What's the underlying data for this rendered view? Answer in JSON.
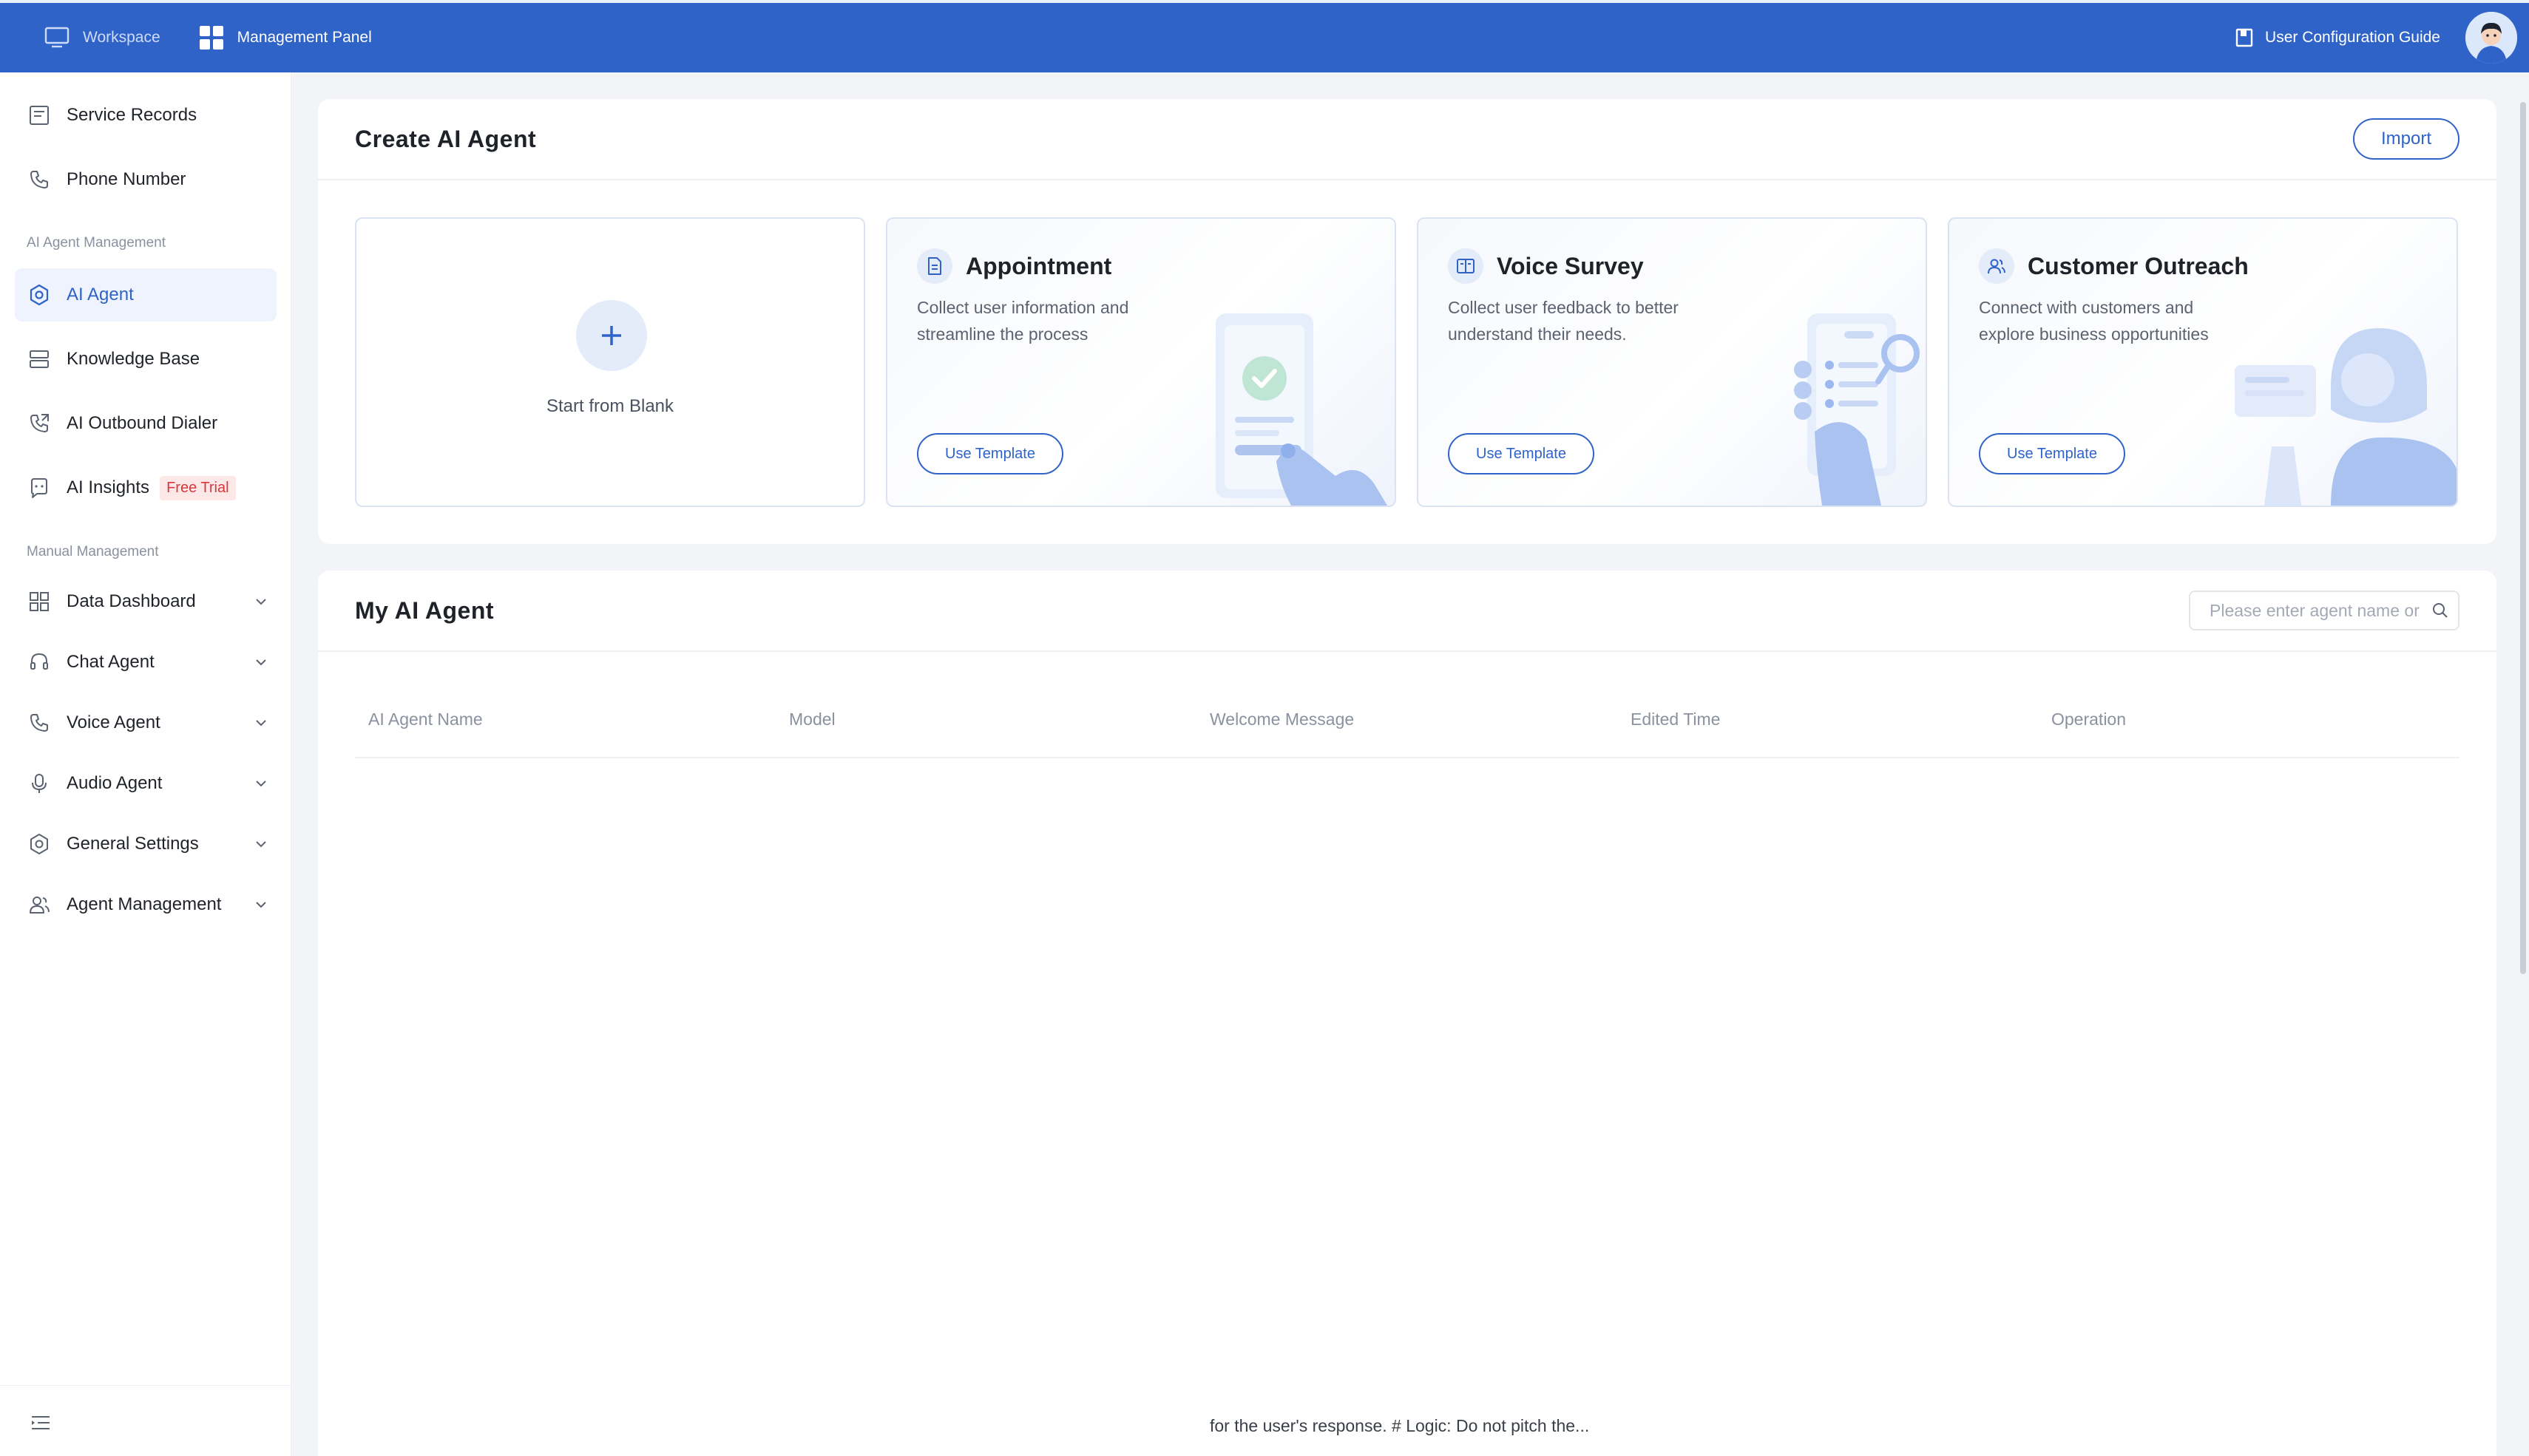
{
  "topbar": {
    "nav": [
      {
        "label": "Workspace",
        "icon": "monitor-icon",
        "active": false
      },
      {
        "label": "Management Panel",
        "icon": "grid-icon",
        "active": true
      }
    ],
    "guide_label": "User Configuration Guide",
    "colors": {
      "bar": "#2f63c8",
      "accent": "#2f63c8"
    }
  },
  "sidebar": {
    "items": [
      {
        "label": "Service Records",
        "icon": "document-icon"
      },
      {
        "label": "Phone Number",
        "icon": "phone-icon"
      }
    ],
    "section_ai": "AI Agent Management",
    "ai_items": [
      {
        "label": "AI Agent",
        "icon": "settings-icon",
        "active": true
      },
      {
        "label": "Knowledge Base",
        "icon": "database-icon"
      },
      {
        "label": "AI Outbound Dialer",
        "icon": "phone-outgoing-icon"
      },
      {
        "label": "AI Insights",
        "icon": "insights-icon",
        "badge": "Free Trial"
      }
    ],
    "section_manual": "Manual Management",
    "manual_items": [
      {
        "label": "Data Dashboard",
        "icon": "dashboard-icon"
      },
      {
        "label": "Chat Agent",
        "icon": "headset-icon"
      },
      {
        "label": "Voice Agent",
        "icon": "phone-icon"
      },
      {
        "label": "Audio Agent",
        "icon": "microphone-icon"
      },
      {
        "label": "General Settings",
        "icon": "gear-icon"
      },
      {
        "label": "Agent Management",
        "icon": "users-icon"
      }
    ]
  },
  "create": {
    "title": "Create AI Agent",
    "import_label": "Import",
    "blank_label": "Start from Blank",
    "templates": [
      {
        "title": "Appointment",
        "description": "Collect user information and streamline the process",
        "button": "Use Template",
        "icon": "document-icon"
      },
      {
        "title": "Voice Survey",
        "description": "Collect user feedback to better understand their needs.",
        "button": "Use Template",
        "icon": "book-icon"
      },
      {
        "title": "Customer Outreach",
        "description": "Connect with customers and explore business opportunities",
        "button": "Use Template",
        "icon": "users-icon"
      }
    ]
  },
  "list": {
    "title": "My AI Agent",
    "search_placeholder": "Please enter agent name or",
    "columns": [
      "AI Agent Name",
      "Model",
      "Welcome Message",
      "Edited Time",
      "Operation"
    ],
    "partial_row": [
      "",
      "",
      "for the user's response. # Logic: Do not pitch the...",
      "",
      ""
    ]
  }
}
